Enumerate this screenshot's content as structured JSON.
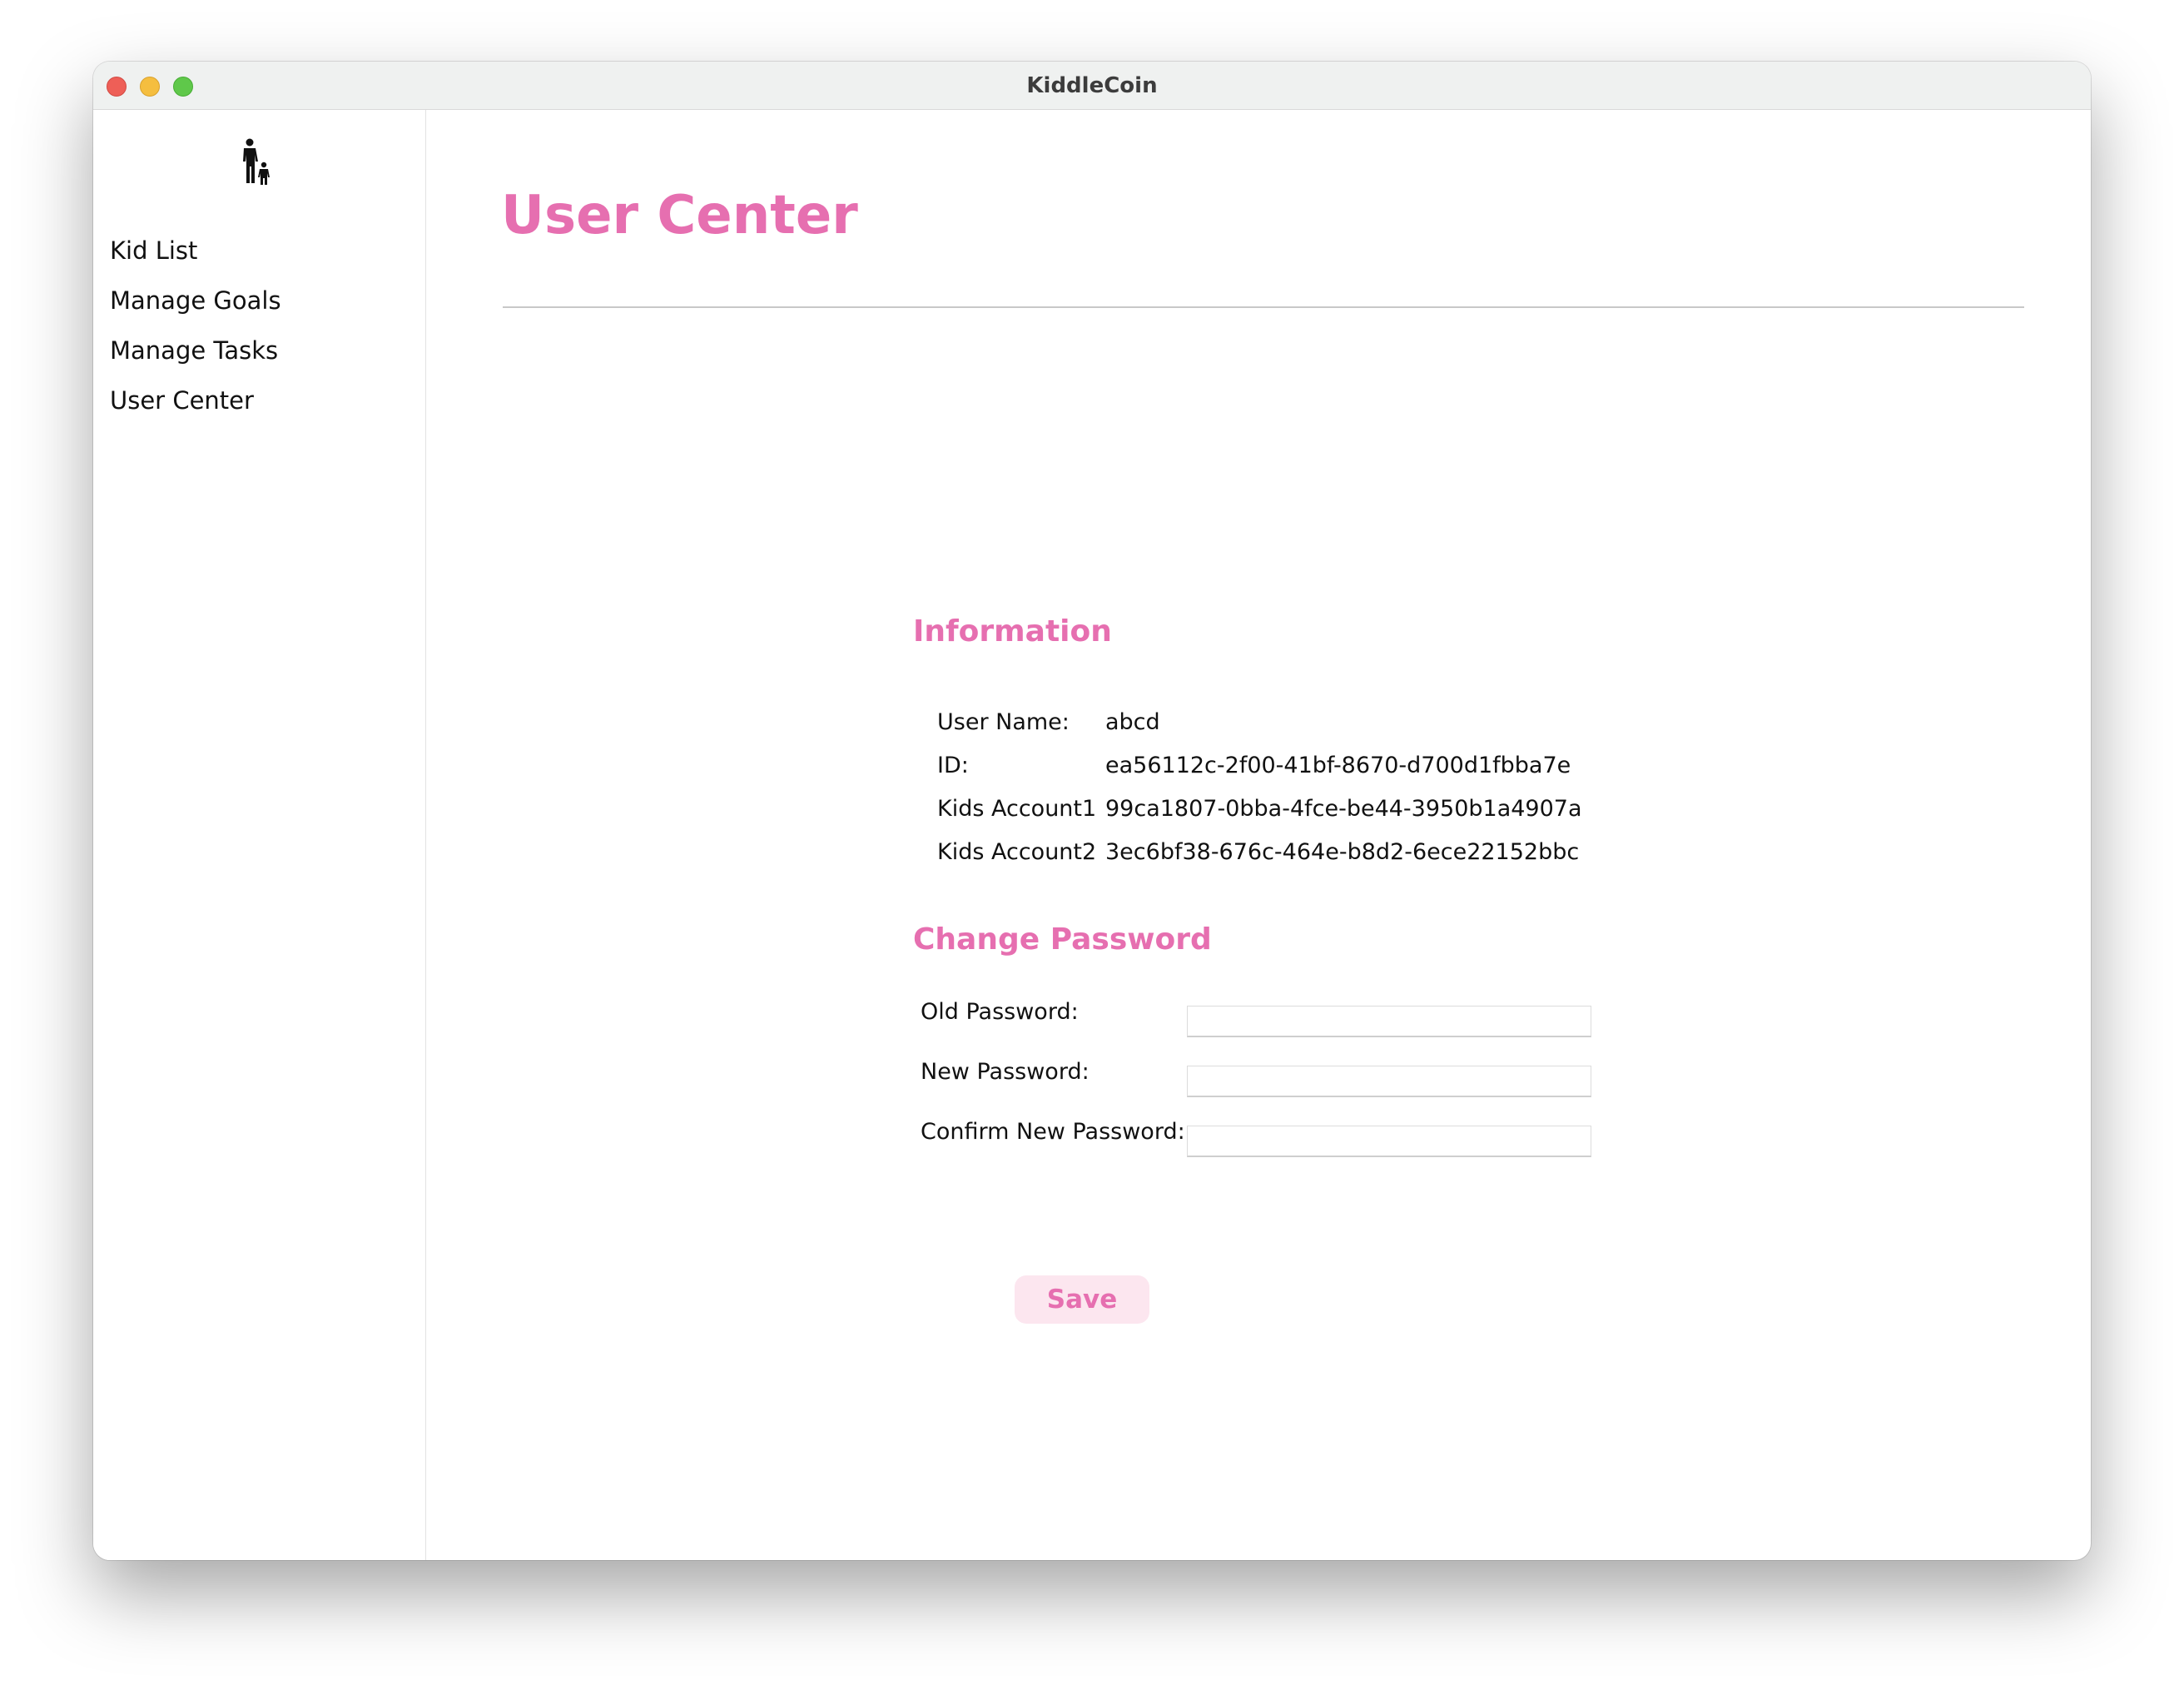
{
  "window": {
    "title": "KiddleCoin"
  },
  "sidebar": {
    "logo_icon": "parent-child-icon",
    "items": [
      {
        "label": "Kid List"
      },
      {
        "label": "Manage Goals"
      },
      {
        "label": "Manage Tasks"
      },
      {
        "label": "User Center"
      }
    ]
  },
  "main": {
    "title": "User Center",
    "information": {
      "heading": "Information",
      "rows": [
        {
          "label": "User Name:",
          "value": "abcd"
        },
        {
          "label": "ID:",
          "value": "ea56112c-2f00-41bf-8670-d700d1fbba7e"
        },
        {
          "label": "Kids Account1",
          "value": "99ca1807-0bba-4fce-be44-3950b1a4907a"
        },
        {
          "label": "Kids Account2",
          "value": "3ec6bf38-676c-464e-b8d2-6ece22152bbc"
        }
      ]
    },
    "change_password": {
      "heading": "Change Password",
      "old_label": "Old Password:",
      "new_label": "New Password:",
      "confirm_label": "Confirm New Password:",
      "old_value": "",
      "new_value": "",
      "confirm_value": "",
      "save_label": "Save"
    }
  },
  "colors": {
    "accent": "#e66fb0",
    "button_bg": "#fce6ef",
    "close": "#ee5f57",
    "minimize": "#f5be3f",
    "zoom": "#5fc84a"
  }
}
